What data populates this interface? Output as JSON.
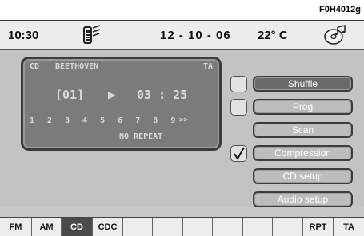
{
  "figure_code": "F0H4012g",
  "status": {
    "time": "10:30",
    "date": "12 - 10 - 06",
    "temperature": "22° C",
    "signal_icon": "phone-signal-icon",
    "disc_icon": "cd-music-icon"
  },
  "display": {
    "source": "CD",
    "artist": "BEETHOVEN",
    "ta": "TA",
    "track": "[01]",
    "play_symbol": "▶",
    "elapsed": "03 : 25",
    "track_list": "1 2 3 4 5 6 7 8 9",
    "more": ">>",
    "repeat": "NO REPEAT"
  },
  "checkboxes": [
    {
      "checked": false
    },
    {
      "checked": false
    },
    {
      "checked": true
    }
  ],
  "menu": [
    {
      "label": "Shuffle",
      "active": true
    },
    {
      "label": "Prog"
    },
    {
      "label": "Scan"
    },
    {
      "label": "Compression"
    },
    {
      "label": "CD setup"
    },
    {
      "label": "Audio setup"
    }
  ],
  "bottom_bar": {
    "fm": "FM",
    "am": "AM",
    "cd": "CD",
    "cdc": "CDC",
    "rpt": "RPT",
    "ta": "TA"
  }
}
